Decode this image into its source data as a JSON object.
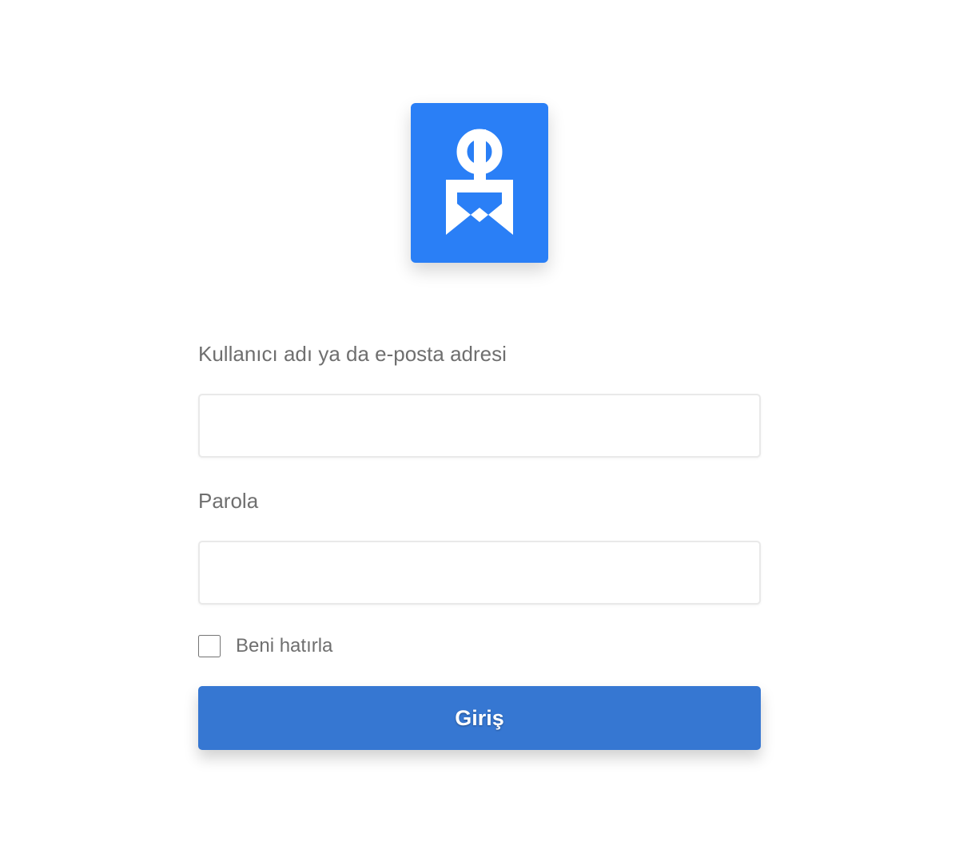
{
  "brand": {
    "logo_icon": "ek-logo-icon",
    "logo_color": "#2a7ff6",
    "logo_mark_color": "#ffffff"
  },
  "login_form": {
    "username_label": "Kullanıcı adı ya da e-posta adresi",
    "username_value": "",
    "password_label": "Parola",
    "password_value": "",
    "remember_label": "Beni hatırla",
    "remember_checked": false,
    "submit_label": "Giriş",
    "submit_color": "#3677d2"
  }
}
